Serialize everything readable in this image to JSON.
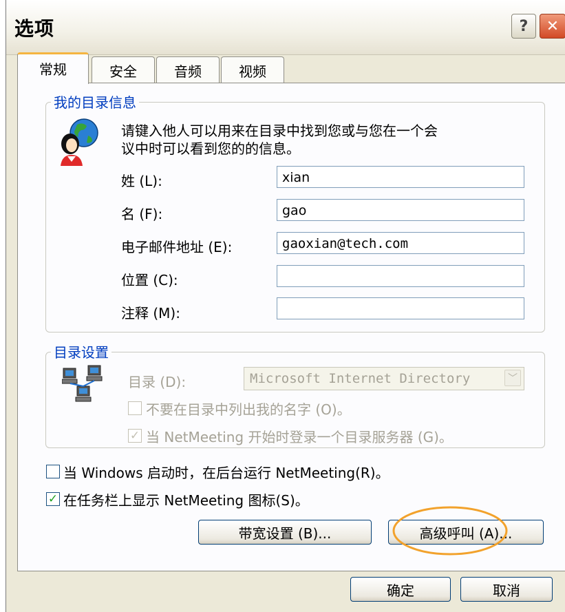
{
  "title": "选项",
  "title_buttons": {
    "help": "?",
    "close": "✕"
  },
  "tabs": [
    {
      "label": "常规"
    },
    {
      "label": "安全"
    },
    {
      "label": "音频"
    },
    {
      "label": "视频"
    }
  ],
  "my_info": {
    "legend": "我的目录信息",
    "description_line1": "请键入他人可以用来在目录中找到您或与您在一个会",
    "description_line2": "议中时可以看到您的的信息。",
    "fields": [
      {
        "label": "姓 (L):",
        "value": "xian"
      },
      {
        "label": "名 (F):",
        "value": "gao"
      },
      {
        "label": "电子邮件地址 (E):",
        "value": "gaoxian@tech.com"
      },
      {
        "label": "位置 (C):",
        "value": ""
      },
      {
        "label": "注释 (M):",
        "value": ""
      }
    ]
  },
  "directory": {
    "legend": "目录设置",
    "label": "目录 (D):",
    "selected": "Microsoft Internet Directory",
    "dropdown_arrow": "﹀",
    "no_list_checkbox": {
      "label": "不要在目录中列出我的名字 (O)。",
      "checked": false
    },
    "login_checkbox": {
      "label": "当 NetMeeting 开始时登录一个目录服务器 (G)。",
      "checked": true
    }
  },
  "options": [
    {
      "label": "当 Windows 启动时，在后台运行 NetMeeting(R)。",
      "checked": false
    },
    {
      "label": "在任务栏上显示 NetMeeting 图标(S)。",
      "checked": true
    }
  ],
  "buttons": {
    "bandwidth": "带宽设置 (B)...",
    "advanced_calling": "高级呼叫 (A)...",
    "ok": "确定",
    "cancel": "取消"
  },
  "check_mark": "✓",
  "highlight_color": "#f2a22c"
}
